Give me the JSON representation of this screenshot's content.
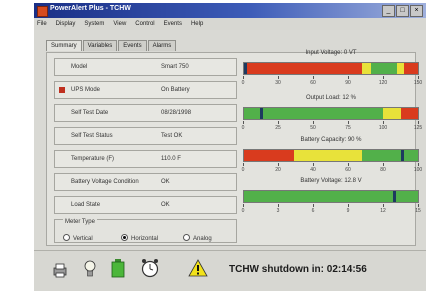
{
  "window": {
    "title": "PowerAlert Plus - TCHW"
  },
  "menu": [
    "File",
    "Display",
    "System",
    "View",
    "Control",
    "Events",
    "Help"
  ],
  "tabs": [
    "Summary",
    "Variables",
    "Events",
    "Alarms"
  ],
  "rows": [
    {
      "label": "Model",
      "value": "Smart 750"
    },
    {
      "label": "UPS Mode",
      "value": "On Battery",
      "alert": true
    },
    {
      "label": "Self Test Date",
      "value": "08/28/1998"
    },
    {
      "label": "Self Test Status",
      "value": "Test OK"
    },
    {
      "label": "Temperature (F)",
      "value": "110.0 F"
    },
    {
      "label": "Battery Voltage Condition",
      "value": "OK"
    },
    {
      "label": "Load State",
      "value": "OK"
    }
  ],
  "meter_type": {
    "legend": "Meter Type",
    "options": [
      "Vertical",
      "Horizontal",
      "Analog"
    ],
    "selected": "Horizontal"
  },
  "gauges": [
    {
      "title": "Input Voltage: 0 VT",
      "ticks": [
        "0",
        "30",
        "60",
        "90",
        "120",
        "150"
      ],
      "max": 150,
      "value": 0,
      "segments": [
        {
          "color": "#d93b1e",
          "from": 0,
          "to": 0.68
        },
        {
          "color": "#e8e23a",
          "from": 0.68,
          "to": 0.73
        },
        {
          "color": "#52b04a",
          "from": 0.73,
          "to": 0.88
        },
        {
          "color": "#e8e23a",
          "from": 0.88,
          "to": 0.92
        },
        {
          "color": "#d93b1e",
          "from": 0.92,
          "to": 1
        }
      ]
    },
    {
      "title": "Output Load: 12 %",
      "ticks": [
        "0",
        "25",
        "50",
        "75",
        "100",
        "125"
      ],
      "max": 125,
      "value": 12,
      "segments": [
        {
          "color": "#52b04a",
          "from": 0,
          "to": 0.8
        },
        {
          "color": "#e8e23a",
          "from": 0.8,
          "to": 0.9
        },
        {
          "color": "#d93b1e",
          "from": 0.9,
          "to": 1
        }
      ]
    },
    {
      "title": "Battery Capacity: 90 %",
      "ticks": [
        "0",
        "20",
        "40",
        "60",
        "80",
        "100"
      ],
      "max": 100,
      "value": 90,
      "segments": [
        {
          "color": "#d93b1e",
          "from": 0,
          "to": 0.29
        },
        {
          "color": "#e8e23a",
          "from": 0.29,
          "to": 0.68
        },
        {
          "color": "#52b04a",
          "from": 0.68,
          "to": 1
        }
      ]
    },
    {
      "title": "Battery Voltage: 12.8 V",
      "ticks": [
        "0",
        "3",
        "6",
        "9",
        "12",
        "15"
      ],
      "max": 15,
      "value": 12.8,
      "segments": [
        {
          "color": "#52b04a",
          "from": 0,
          "to": 1
        }
      ]
    }
  ],
  "status": {
    "icons": [
      "printer-icon",
      "bulb-icon",
      "battery-icon",
      "clock-icon",
      "warning-icon"
    ],
    "shutdown_text": "TCHW shutdown in: 02:14:56"
  },
  "colors": {
    "red": "#d93b1e",
    "yellow": "#e8e23a",
    "green": "#52b04a",
    "needle": "#1d3a5f"
  }
}
